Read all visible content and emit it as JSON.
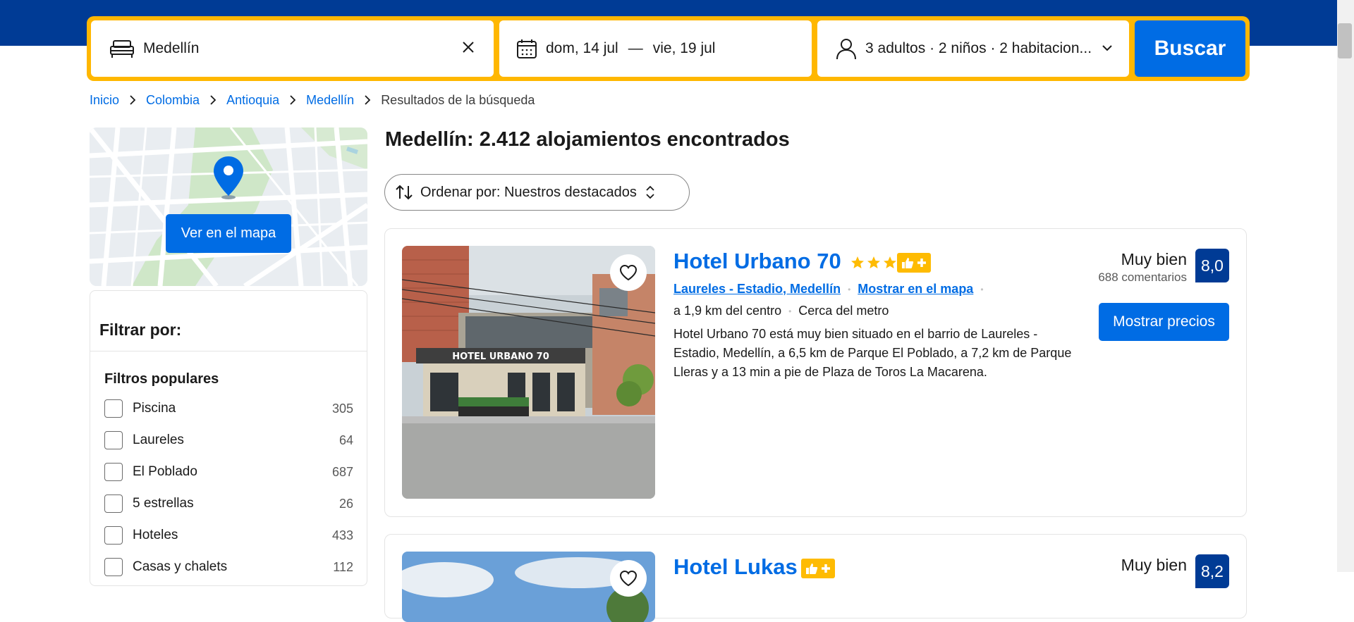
{
  "search": {
    "destination": "Medellín",
    "date_from": "dom, 14 jul",
    "date_sep": "—",
    "date_to": "vie, 19 jul",
    "guests": "3 adultos · 2 niños · 2 habitacion...",
    "button": "Buscar"
  },
  "breadcrumb": [
    "Inicio",
    "Colombia",
    "Antioquia",
    "Medellín",
    "Resultados de la búsqueda"
  ],
  "map": {
    "button": "Ver en el mapa"
  },
  "filters": {
    "title": "Filtrar por:",
    "group_title": "Filtros populares",
    "items": [
      {
        "label": "Piscina",
        "count": "305"
      },
      {
        "label": "Laureles",
        "count": "64"
      },
      {
        "label": "El Poblado",
        "count": "687"
      },
      {
        "label": "5 estrellas",
        "count": "26"
      },
      {
        "label": "Hoteles",
        "count": "433"
      },
      {
        "label": "Casas y chalets",
        "count": "112"
      }
    ]
  },
  "results": {
    "title": "Medellín: 2.412 alojamientos encontrados",
    "sort_label": "Ordenar por: Nuestros destacados"
  },
  "hotels": [
    {
      "name": "Hotel Urbano 70",
      "stars": 3,
      "sign_text": "HOTEL URBANO 70",
      "location": "Laureles - Estadio, Medellín",
      "map_link": "Mostrar en el mapa",
      "distance": "a 1,9 km del centro",
      "metro": "Cerca del metro",
      "description": "Hotel Urbano 70 está muy bien situado en el barrio de Laureles - Estadio, Medellín, a 6,5 km de Parque El Poblado, a 7,2 km de Parque Lleras y a 13 min a pie de Plaza de Toros La Macarena.",
      "score_label": "Muy bien",
      "reviews": "688 comentarios",
      "score": "8,0",
      "price_button": "Mostrar precios"
    },
    {
      "name": "Hotel Lukas",
      "score_label": "Muy bien",
      "score": "8,2"
    }
  ],
  "colors": {
    "brand_blue": "#003b95",
    "action_blue": "#006ce4",
    "search_border": "#ffb700",
    "star": "#febb02"
  },
  "icons": [
    "bed-icon",
    "close-icon",
    "calendar-icon",
    "person-icon",
    "chevron-down-icon",
    "chevron-right-icon",
    "sort-icon",
    "updown-icon",
    "map-pin-icon",
    "heart-icon",
    "thumbs-up-icon",
    "plus-icon",
    "star-icon"
  ]
}
